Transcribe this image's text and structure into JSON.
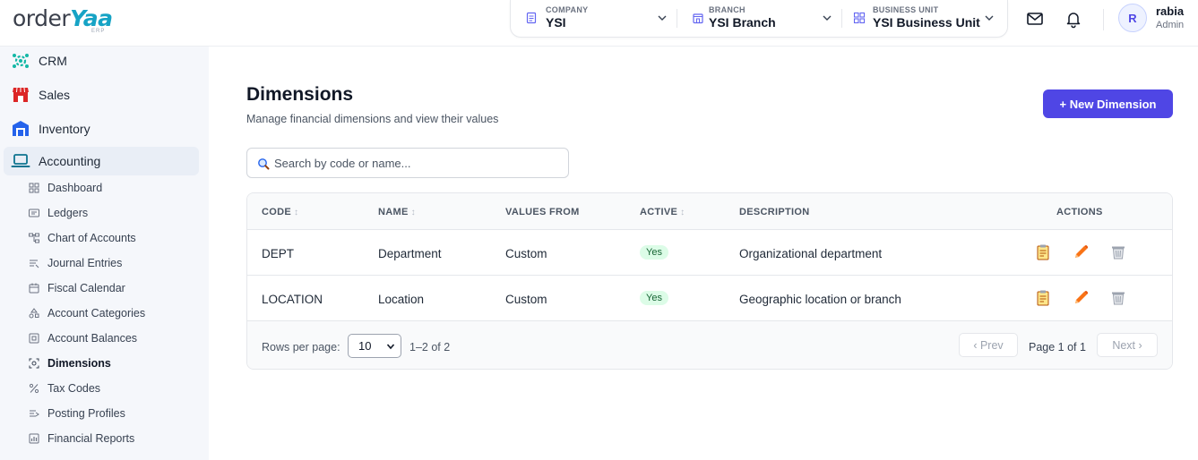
{
  "brand": {
    "name_part1": "order",
    "name_part2": "Yaa",
    "tagline": "ERP"
  },
  "context": {
    "company": {
      "label": "COMPANY",
      "value": "YSI"
    },
    "branch": {
      "label": "BRANCH",
      "value": "YSI Branch"
    },
    "business_unit": {
      "label": "BUSINESS UNIT",
      "value": "YSI Business Unit"
    }
  },
  "user": {
    "initial": "R",
    "name": "rabia",
    "role": "Admin"
  },
  "sidebar": {
    "modules": [
      {
        "label": "CRM",
        "icon": "users-gear-icon"
      },
      {
        "label": "Sales",
        "icon": "storefront-icon"
      },
      {
        "label": "Inventory",
        "icon": "warehouse-icon"
      },
      {
        "label": "Accounting",
        "icon": "laptop-icon"
      }
    ],
    "accounting_items": [
      {
        "label": "Dashboard",
        "icon": "dashboard-icon"
      },
      {
        "label": "Ledgers",
        "icon": "ledger-icon"
      },
      {
        "label": "Chart of Accounts",
        "icon": "hierarchy-icon"
      },
      {
        "label": "Journal Entries",
        "icon": "journal-icon"
      },
      {
        "label": "Fiscal Calendar",
        "icon": "calendar-icon"
      },
      {
        "label": "Account Categories",
        "icon": "categories-icon"
      },
      {
        "label": "Account Balances",
        "icon": "balance-icon"
      },
      {
        "label": "Dimensions",
        "icon": "dimensions-icon"
      },
      {
        "label": "Tax Codes",
        "icon": "percent-icon"
      },
      {
        "label": "Posting Profiles",
        "icon": "posting-icon"
      },
      {
        "label": "Financial Reports",
        "icon": "report-icon"
      }
    ]
  },
  "page": {
    "title": "Dimensions",
    "subtitle": "Manage financial dimensions and view their values",
    "new_button": "+ New Dimension",
    "search_placeholder": "Search by code or name..."
  },
  "table": {
    "columns": [
      "CODE",
      "NAME",
      "VALUES FROM",
      "ACTIVE",
      "DESCRIPTION",
      "ACTIONS"
    ],
    "sort_glyph": "↕",
    "rows": [
      {
        "code": "DEPT",
        "name": "Department",
        "values_from": "Custom",
        "active": "Yes",
        "description": "Organizational department"
      },
      {
        "code": "LOCATION",
        "name": "Location",
        "values_from": "Custom",
        "active": "Yes",
        "description": "Geographic location or branch"
      }
    ]
  },
  "pagination": {
    "rows_per_page_label": "Rows per page:",
    "rows_per_page": "10",
    "range": "1–2 of 2",
    "prev": "‹ Prev",
    "page_info": "Page 1 of 1",
    "next": "Next ›"
  },
  "colors": {
    "primary": "#4f46e5",
    "active_badge_bg": "#dcfce7",
    "active_badge_text": "#166534",
    "sidebar_bg": "#f5f7fb"
  }
}
